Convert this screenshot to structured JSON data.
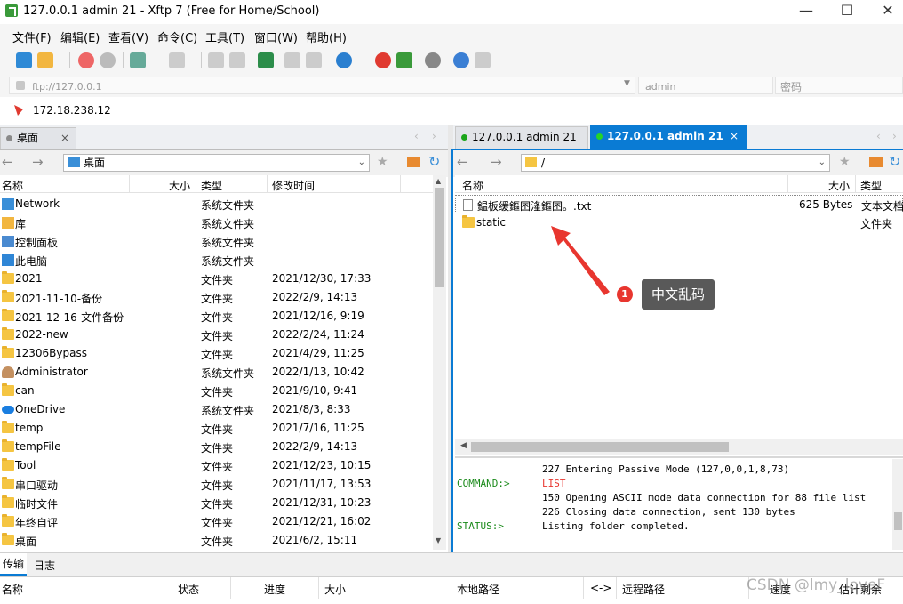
{
  "window": {
    "title": "127.0.0.1 admin 21 - Xftp 7 (Free for Home/School)"
  },
  "menu": [
    "文件(F)",
    "编辑(E)",
    "查看(V)",
    "命令(C)",
    "工具(T)",
    "窗口(W)",
    "帮助(H)"
  ],
  "address": {
    "host": "ftp://127.0.0.1",
    "user": "admin",
    "password": "密码"
  },
  "session": {
    "label": "172.18.238.12"
  },
  "left": {
    "tab": "桌面",
    "path": "桌面",
    "columns": {
      "name": "名称",
      "size": "大小",
      "type": "类型",
      "modified": "修改时间"
    },
    "rows": [
      {
        "name": "Network",
        "type": "系统文件夹",
        "modified": "",
        "icon": "network-icon"
      },
      {
        "name": "库",
        "type": "系统文件夹",
        "modified": "",
        "icon": "library-icon"
      },
      {
        "name": "控制面板",
        "type": "系统文件夹",
        "modified": "",
        "icon": "control-panel-icon"
      },
      {
        "name": "此电脑",
        "type": "系统文件夹",
        "modified": "",
        "icon": "computer-icon"
      },
      {
        "name": "2021",
        "type": "文件夹",
        "modified": "2021/12/30, 17:33",
        "icon": "folder-icon"
      },
      {
        "name": "2021-11-10-备份",
        "type": "文件夹",
        "modified": "2022/2/9, 14:13",
        "icon": "folder-icon"
      },
      {
        "name": "2021-12-16-文件备份",
        "type": "文件夹",
        "modified": "2021/12/16, 9:19",
        "icon": "folder-icon"
      },
      {
        "name": "2022-new",
        "type": "文件夹",
        "modified": "2022/2/24, 11:24",
        "icon": "folder-icon"
      },
      {
        "name": "12306Bypass",
        "type": "文件夹",
        "modified": "2021/4/29, 11:25",
        "icon": "folder-icon"
      },
      {
        "name": "Administrator",
        "type": "系统文件夹",
        "modified": "2022/1/13, 10:42",
        "icon": "user-icon"
      },
      {
        "name": "can",
        "type": "文件夹",
        "modified": "2021/9/10, 9:41",
        "icon": "folder-icon"
      },
      {
        "name": "OneDrive",
        "type": "系统文件夹",
        "modified": "2021/8/3, 8:33",
        "icon": "cloud-icon"
      },
      {
        "name": "temp",
        "type": "文件夹",
        "modified": "2021/7/16, 11:25",
        "icon": "folder-icon"
      },
      {
        "name": "tempFile",
        "type": "文件夹",
        "modified": "2022/2/9, 14:13",
        "icon": "folder-icon"
      },
      {
        "name": "Tool",
        "type": "文件夹",
        "modified": "2021/12/23, 10:15",
        "icon": "folder-icon"
      },
      {
        "name": "串口驱动",
        "type": "文件夹",
        "modified": "2021/11/17, 13:53",
        "icon": "folder-icon"
      },
      {
        "name": "临时文件",
        "type": "文件夹",
        "modified": "2021/12/31, 10:23",
        "icon": "folder-icon"
      },
      {
        "name": "年终自评",
        "type": "文件夹",
        "modified": "2021/12/21, 16:02",
        "icon": "folder-icon"
      },
      {
        "name": "桌面",
        "type": "文件夹",
        "modified": "2021/6/2, 15:11",
        "icon": "folder-icon"
      }
    ]
  },
  "right": {
    "tabs": [
      "127.0.0.1 admin 21",
      "127.0.0.1 admin 21"
    ],
    "path": "/",
    "columns": {
      "name": "名称",
      "size": "大小",
      "type": "类型"
    },
    "rows": [
      {
        "name": "鎾板缓鏂囨湰鏂囨。.txt",
        "size": "625 Bytes",
        "type": "文本文档",
        "icon": "text-file-icon"
      },
      {
        "name": "static",
        "size": "",
        "type": "文件夹",
        "icon": "folder-icon"
      }
    ],
    "log": [
      {
        "prefix": "",
        "text": "227 Entering Passive Mode (127,0,0,1,8,73)"
      },
      {
        "prefix": "COMMAND:>",
        "text": "LIST"
      },
      {
        "prefix": "",
        "text": "150 Opening ASCII mode data connection for  88 file list"
      },
      {
        "prefix": "",
        "text": "226 Closing data connection, sent 130 bytes"
      },
      {
        "prefix": "STATUS:>",
        "text": "Listing folder completed."
      }
    ]
  },
  "annotation": {
    "number": "1",
    "label": "中文乱码"
  },
  "bottom": {
    "tabs": [
      "传输",
      "日志"
    ],
    "columns": [
      "名称",
      "状态",
      "进度",
      "大小",
      "本地路径",
      "<->",
      "远程路径",
      "速度",
      "估计剩余"
    ],
    "watermark": "CSDN @lmy_loveF"
  },
  "colors": {
    "accent": "#0a7bd4",
    "arrow": "#e8362f",
    "command": "#1a8a1a"
  }
}
